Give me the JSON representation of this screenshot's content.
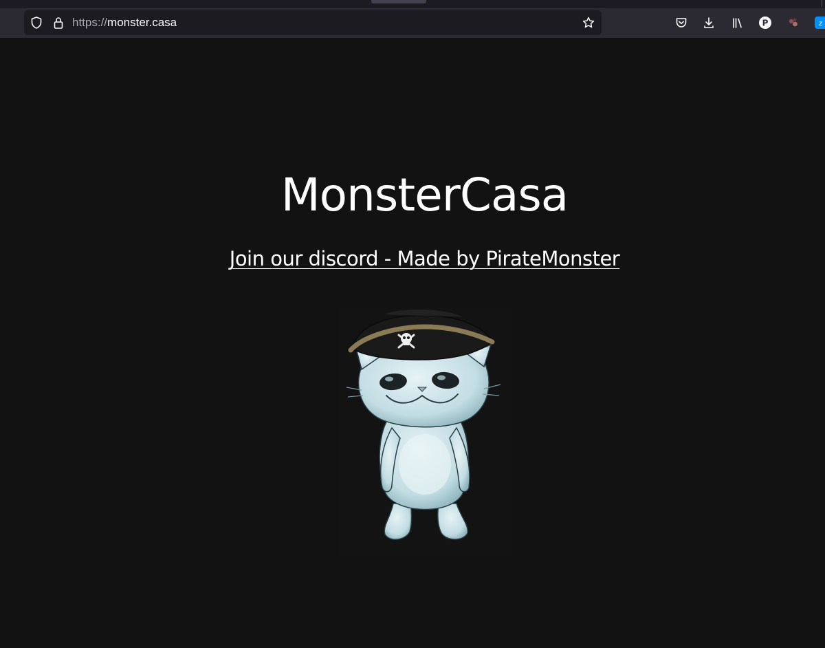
{
  "browser": {
    "url_scheme": "https://",
    "url_host": "monster.casa",
    "profile_initial": "P",
    "extension_label": "z"
  },
  "page": {
    "title": "MonsterCasa",
    "link_text": "Join our discord - Made by PirateMonster",
    "mascot_alt": "pirate-cat-mascot"
  },
  "colors": {
    "background": "#121212",
    "toolbar": "#2b2a33",
    "urlbar": "#1c1b22",
    "text": "#ffffff",
    "accent": "#0090ff"
  },
  "icons": [
    "shield-icon",
    "lock-icon",
    "bookmark-star-icon",
    "pocket-icon",
    "download-icon",
    "library-icon",
    "profile-icon",
    "extension-icon",
    "zoom-extension-icon"
  ]
}
